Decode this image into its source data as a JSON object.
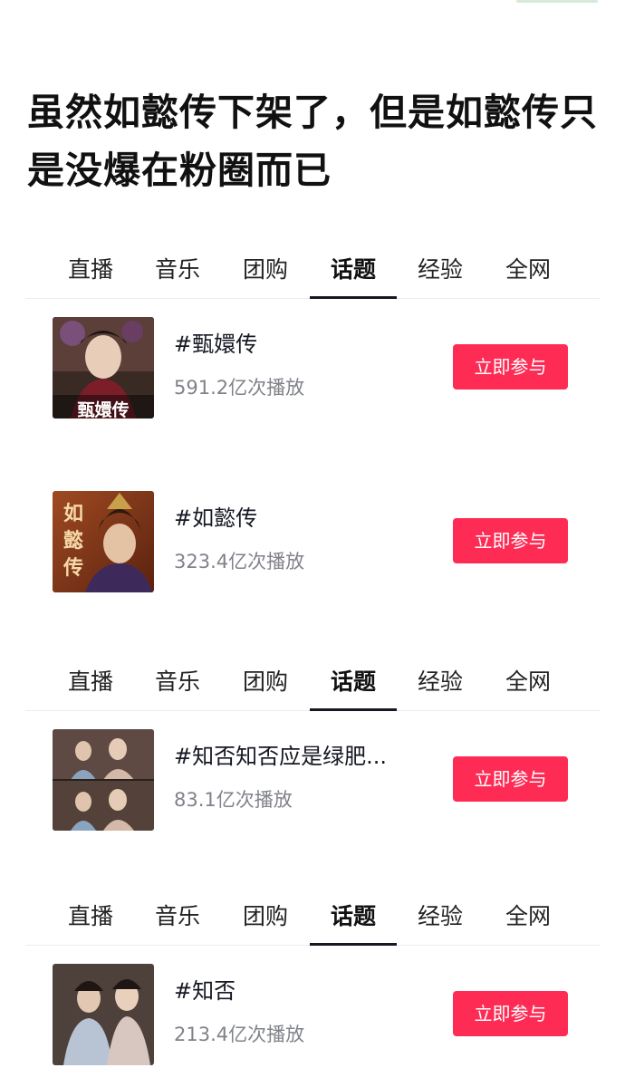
{
  "headline": "虽然如懿传下架了，但是如懿传只是没爆在粉圈而已",
  "tabs": [
    "直播",
    "音乐",
    "团购",
    "话题",
    "经验",
    "全网"
  ],
  "active_tab": "话题",
  "topics": [
    {
      "title": "#甄嬛传",
      "plays": "591.2亿次播放",
      "button": "立即参与",
      "poster_text": "甄嬛传",
      "thumb": "thumbnail-zhenhuan"
    },
    {
      "title": "#如懿传",
      "plays": "323.4亿次播放",
      "button": "立即参与",
      "poster_text": "如懿传",
      "thumb": "thumbnail-ruyi"
    },
    {
      "title": "#知否知否应是绿肥...",
      "plays": "83.1亿次播放",
      "button": "立即参与",
      "poster_text": "",
      "thumb": "thumbnail-zhifou"
    },
    {
      "title": "#知否",
      "plays": "213.4亿次播放",
      "button": "立即参与",
      "poster_text": "",
      "thumb": "thumbnail-zhifou-2"
    }
  ],
  "colors": {
    "accent": "#fe2c55",
    "tab_underline": "#161823",
    "secondary_text": "#80828a"
  }
}
